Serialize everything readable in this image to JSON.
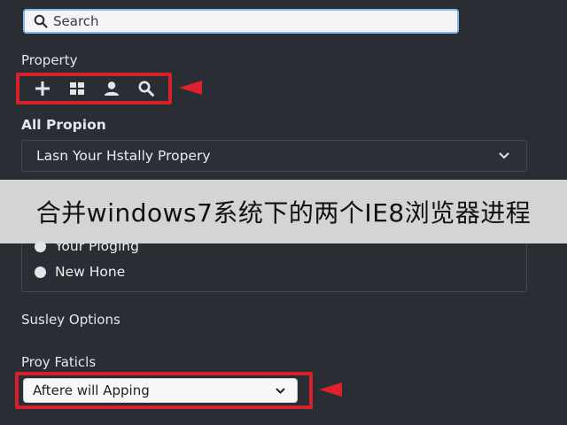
{
  "search": {
    "placeholder": "Search"
  },
  "property": {
    "label": "Property",
    "tools": [
      "plus-icon",
      "grid-icon",
      "user-icon",
      "search-icon"
    ]
  },
  "all_propion": {
    "label": "All Propion",
    "selected": "Lasn Your Hstally Propery"
  },
  "radio_group": {
    "options": [
      "Your Ploging",
      "New Hone"
    ]
  },
  "sections": {
    "susley": "Susley Options",
    "proy": "Proy Faticls"
  },
  "proy_select": {
    "selected": "Aftere will Apping"
  },
  "overlay": {
    "text": "合并windows7系统下的两个IE8浏览器进程"
  },
  "colors": {
    "background": "#2a2d33",
    "highlight": "#d6202a",
    "search_border": "#8fb7e6"
  }
}
